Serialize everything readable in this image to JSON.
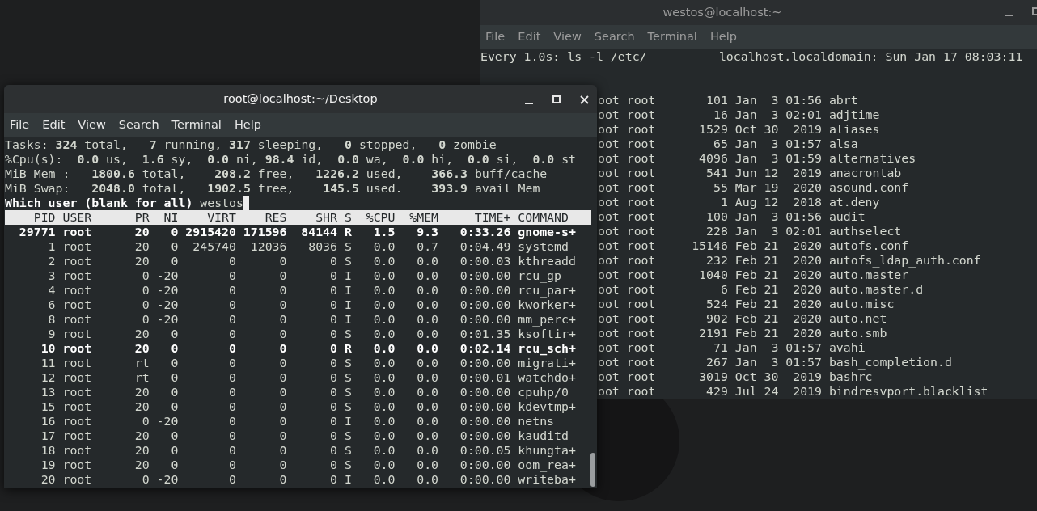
{
  "background_window": {
    "title": "westos@localhost:~",
    "active": false,
    "menu": [
      "File",
      "Edit",
      "View",
      "Search",
      "Terminal",
      "Help"
    ],
    "header_line": "Every 1.0s: ls -l /etc/          localhost.localdomain: Sun Jan 17 08:03:11",
    "listing": [
      {
        "owner": "oot root",
        "size": "101",
        "month": "Jan",
        "day": "3",
        "time": "01:56",
        "name": "abrt"
      },
      {
        "owner": "oot root",
        "size": "16",
        "month": "Jan",
        "day": "3",
        "time": "02:01",
        "name": "adjtime"
      },
      {
        "owner": "oot root",
        "size": "1529",
        "month": "Oct",
        "day": "30",
        "time": "2019",
        "name": "aliases"
      },
      {
        "owner": "oot root",
        "size": "65",
        "month": "Jan",
        "day": "3",
        "time": "01:57",
        "name": "alsa"
      },
      {
        "owner": "oot root",
        "size": "4096",
        "month": "Jan",
        "day": "3",
        "time": "01:59",
        "name": "alternatives"
      },
      {
        "owner": "oot root",
        "size": "541",
        "month": "Jun",
        "day": "12",
        "time": "2019",
        "name": "anacrontab"
      },
      {
        "owner": "oot root",
        "size": "55",
        "month": "Mar",
        "day": "19",
        "time": "2020",
        "name": "asound.conf"
      },
      {
        "owner": "oot root",
        "size": "1",
        "month": "Aug",
        "day": "12",
        "time": "2018",
        "name": "at.deny"
      },
      {
        "owner": "oot root",
        "size": "100",
        "month": "Jan",
        "day": "3",
        "time": "01:56",
        "name": "audit"
      },
      {
        "owner": "oot root",
        "size": "228",
        "month": "Jan",
        "day": "3",
        "time": "02:01",
        "name": "authselect"
      },
      {
        "owner": "oot root",
        "size": "15146",
        "month": "Feb",
        "day": "21",
        "time": "2020",
        "name": "autofs.conf"
      },
      {
        "owner": "oot root",
        "size": "232",
        "month": "Feb",
        "day": "21",
        "time": "2020",
        "name": "autofs_ldap_auth.conf"
      },
      {
        "owner": "oot root",
        "size": "1040",
        "month": "Feb",
        "day": "21",
        "time": "2020",
        "name": "auto.master"
      },
      {
        "owner": "oot root",
        "size": "6",
        "month": "Feb",
        "day": "21",
        "time": "2020",
        "name": "auto.master.d"
      },
      {
        "owner": "oot root",
        "size": "524",
        "month": "Feb",
        "day": "21",
        "time": "2020",
        "name": "auto.misc"
      },
      {
        "owner": "oot root",
        "size": "902",
        "month": "Feb",
        "day": "21",
        "time": "2020",
        "name": "auto.net"
      },
      {
        "owner": "oot root",
        "size": "2191",
        "month": "Feb",
        "day": "21",
        "time": "2020",
        "name": "auto.smb"
      },
      {
        "owner": "oot root",
        "size": "71",
        "month": "Jan",
        "day": "3",
        "time": "01:57",
        "name": "avahi"
      },
      {
        "owner": "oot root",
        "size": "267",
        "month": "Jan",
        "day": "3",
        "time": "01:57",
        "name": "bash_completion.d"
      },
      {
        "owner": "oot root",
        "size": "3019",
        "month": "Oct",
        "day": "30",
        "time": "2019",
        "name": "bashrc"
      },
      {
        "owner": "oot root",
        "size": "429",
        "month": "Jul",
        "day": "24",
        "time": "2019",
        "name": "bindresvport.blacklist"
      }
    ]
  },
  "foreground_window": {
    "title": "root@localhost:~/Desktop",
    "active": true,
    "menu": [
      "File",
      "Edit",
      "View",
      "Search",
      "Terminal",
      "Help"
    ],
    "summary": [
      "Tasks: **324** total,   **7** running, **317** sleeping,   **0** stopped,   **0** zombie",
      "%Cpu(s):  **0.0** us,  **1.6** sy,  **0.0** ni, **98.4** id,  **0.0** wa,  **0.0** hi,  **0.0** si,  **0.0** st",
      "MiB Mem :   **1800.6** total,    **208.2** free,   **1226.2** used,    **366.3** buff/cache",
      "MiB Swap:   **2048.0** total,   **1902.5** free,    **145.5** used.    **393.9** avail Mem"
    ],
    "prompt": {
      "label": "Which user (blank for all)",
      "value": "westos"
    },
    "columns": [
      "PID",
      "USER",
      "PR",
      "NI",
      "VIRT",
      "RES",
      "SHR",
      "S",
      "%CPU",
      "%MEM",
      "TIME+",
      "COMMAND"
    ],
    "rows": [
      {
        "bold": true,
        "cells": [
          "29771",
          "root",
          "20",
          "0",
          "2915420",
          "171596",
          "84144",
          "R",
          "1.5",
          "9.3",
          "0:33.26",
          "gnome-s+"
        ]
      },
      {
        "bold": false,
        "cells": [
          "1",
          "root",
          "20",
          "0",
          "245740",
          "12036",
          "8036",
          "S",
          "0.0",
          "0.7",
          "0:04.49",
          "systemd"
        ]
      },
      {
        "bold": false,
        "cells": [
          "2",
          "root",
          "20",
          "0",
          "0",
          "0",
          "0",
          "S",
          "0.0",
          "0.0",
          "0:00.03",
          "kthreadd"
        ]
      },
      {
        "bold": false,
        "cells": [
          "3",
          "root",
          "0",
          "-20",
          "0",
          "0",
          "0",
          "I",
          "0.0",
          "0.0",
          "0:00.00",
          "rcu_gp"
        ]
      },
      {
        "bold": false,
        "cells": [
          "4",
          "root",
          "0",
          "-20",
          "0",
          "0",
          "0",
          "I",
          "0.0",
          "0.0",
          "0:00.00",
          "rcu_par+"
        ]
      },
      {
        "bold": false,
        "cells": [
          "6",
          "root",
          "0",
          "-20",
          "0",
          "0",
          "0",
          "I",
          "0.0",
          "0.0",
          "0:00.00",
          "kworker+"
        ]
      },
      {
        "bold": false,
        "cells": [
          "8",
          "root",
          "0",
          "-20",
          "0",
          "0",
          "0",
          "I",
          "0.0",
          "0.0",
          "0:00.00",
          "mm_perc+"
        ]
      },
      {
        "bold": false,
        "cells": [
          "9",
          "root",
          "20",
          "0",
          "0",
          "0",
          "0",
          "S",
          "0.0",
          "0.0",
          "0:01.35",
          "ksoftir+"
        ]
      },
      {
        "bold": true,
        "cells": [
          "10",
          "root",
          "20",
          "0",
          "0",
          "0",
          "0",
          "R",
          "0.0",
          "0.0",
          "0:02.14",
          "rcu_sch+"
        ]
      },
      {
        "bold": false,
        "cells": [
          "11",
          "root",
          "rt",
          "0",
          "0",
          "0",
          "0",
          "S",
          "0.0",
          "0.0",
          "0:00.00",
          "migrati+"
        ]
      },
      {
        "bold": false,
        "cells": [
          "12",
          "root",
          "rt",
          "0",
          "0",
          "0",
          "0",
          "S",
          "0.0",
          "0.0",
          "0:00.01",
          "watchdo+"
        ]
      },
      {
        "bold": false,
        "cells": [
          "13",
          "root",
          "20",
          "0",
          "0",
          "0",
          "0",
          "S",
          "0.0",
          "0.0",
          "0:00.00",
          "cpuhp/0"
        ]
      },
      {
        "bold": false,
        "cells": [
          "15",
          "root",
          "20",
          "0",
          "0",
          "0",
          "0",
          "S",
          "0.0",
          "0.0",
          "0:00.00",
          "kdevtmp+"
        ]
      },
      {
        "bold": false,
        "cells": [
          "16",
          "root",
          "0",
          "-20",
          "0",
          "0",
          "0",
          "I",
          "0.0",
          "0.0",
          "0:00.00",
          "netns"
        ]
      },
      {
        "bold": false,
        "cells": [
          "17",
          "root",
          "20",
          "0",
          "0",
          "0",
          "0",
          "S",
          "0.0",
          "0.0",
          "0:00.00",
          "kauditd"
        ]
      },
      {
        "bold": false,
        "cells": [
          "18",
          "root",
          "20",
          "0",
          "0",
          "0",
          "0",
          "S",
          "0.0",
          "0.0",
          "0:00.05",
          "khungta+"
        ]
      },
      {
        "bold": false,
        "cells": [
          "19",
          "root",
          "20",
          "0",
          "0",
          "0",
          "0",
          "S",
          "0.0",
          "0.0",
          "0:00.00",
          "oom_rea+"
        ]
      },
      {
        "bold": false,
        "cells": [
          "20",
          "root",
          "0",
          "-20",
          "0",
          "0",
          "0",
          "I",
          "0.0",
          "0.0",
          "0:00.00",
          "writeba+"
        ]
      }
    ]
  }
}
